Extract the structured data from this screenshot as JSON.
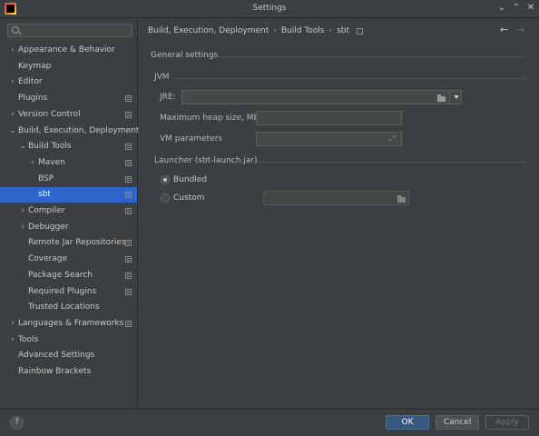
{
  "window": {
    "title": "Settings",
    "controls": {
      "minimize": "⌄",
      "maximize": "⌃",
      "close": "✕"
    }
  },
  "sidebar": {
    "search": {
      "placeholder": "",
      "icon": "search-icon"
    },
    "items": [
      {
        "label": "Appearance & Behavior",
        "expandable": true,
        "expanded": false,
        "level": 0,
        "project_icon": false
      },
      {
        "label": "Keymap",
        "expandable": false,
        "level": 0,
        "project_icon": false
      },
      {
        "label": "Editor",
        "expandable": true,
        "expanded": false,
        "level": 0,
        "project_icon": false
      },
      {
        "label": "Plugins",
        "expandable": false,
        "level": 0,
        "project_icon": true
      },
      {
        "label": "Version Control",
        "expandable": true,
        "expanded": false,
        "level": 0,
        "project_icon": true
      },
      {
        "label": "Build, Execution, Deployment",
        "expandable": true,
        "expanded": true,
        "level": 0,
        "project_icon": false
      },
      {
        "label": "Build Tools",
        "expandable": true,
        "expanded": true,
        "level": 1,
        "project_icon": true
      },
      {
        "label": "Maven",
        "expandable": true,
        "expanded": false,
        "level": 2,
        "project_icon": true
      },
      {
        "label": "BSP",
        "expandable": false,
        "level": 2,
        "project_icon": true
      },
      {
        "label": "sbt",
        "expandable": false,
        "level": 2,
        "project_icon": true,
        "selected": true
      },
      {
        "label": "Compiler",
        "expandable": true,
        "expanded": false,
        "level": 1,
        "project_icon": true
      },
      {
        "label": "Debugger",
        "expandable": true,
        "expanded": false,
        "level": 1,
        "project_icon": false
      },
      {
        "label": "Remote Jar Repositories",
        "expandable": false,
        "level": 1,
        "project_icon": true
      },
      {
        "label": "Coverage",
        "expandable": false,
        "level": 1,
        "project_icon": true
      },
      {
        "label": "Package Search",
        "expandable": false,
        "level": 1,
        "project_icon": true
      },
      {
        "label": "Required Plugins",
        "expandable": false,
        "level": 1,
        "project_icon": true
      },
      {
        "label": "Trusted Locations",
        "expandable": false,
        "level": 1,
        "project_icon": false
      },
      {
        "label": "Languages & Frameworks",
        "expandable": true,
        "expanded": false,
        "level": 0,
        "project_icon": true
      },
      {
        "label": "Tools",
        "expandable": true,
        "expanded": false,
        "level": 0,
        "project_icon": false
      },
      {
        "label": "Advanced Settings",
        "expandable": false,
        "level": 0,
        "project_icon": false
      },
      {
        "label": "Rainbow Brackets",
        "expandable": false,
        "level": 0,
        "project_icon": false
      }
    ]
  },
  "breadcrumb": {
    "parts": [
      "Build, Execution, Deployment",
      "Build Tools",
      "sbt"
    ],
    "separator": "›"
  },
  "nav": {
    "back": "←",
    "forward": "→"
  },
  "content": {
    "general_settings": "General settings",
    "jvm": {
      "title": "JVM",
      "jre_label": "JRE:",
      "jre_value": "",
      "heap_label": "Maximum heap size, MB",
      "heap_value": "",
      "vm_label": "VM parameters",
      "vm_value": ""
    },
    "launcher": {
      "title": "Launcher (sbt-launch.jar)",
      "bundled_label": "Bundled",
      "bundled_checked": true,
      "custom_label": "Custom",
      "custom_checked": false,
      "custom_path": ""
    }
  },
  "footer": {
    "help": "?",
    "ok": "OK",
    "cancel": "Cancel",
    "apply": "Apply"
  },
  "colors": {
    "background": "#3c3f41",
    "selection": "#2f65ca",
    "ok_button": "#365880"
  }
}
